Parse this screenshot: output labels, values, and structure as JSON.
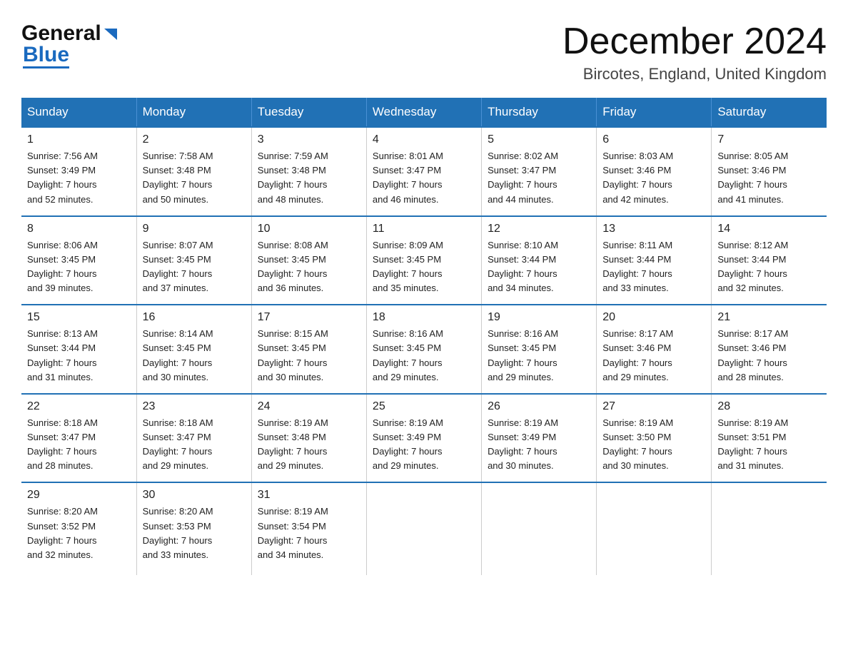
{
  "header": {
    "logo_general": "General",
    "logo_blue": "Blue",
    "month_title": "December 2024",
    "location": "Bircotes, England, United Kingdom"
  },
  "days_of_week": [
    "Sunday",
    "Monday",
    "Tuesday",
    "Wednesday",
    "Thursday",
    "Friday",
    "Saturday"
  ],
  "weeks": [
    [
      {
        "day": "1",
        "sunrise": "7:56 AM",
        "sunset": "3:49 PM",
        "daylight": "7 hours and 52 minutes."
      },
      {
        "day": "2",
        "sunrise": "7:58 AM",
        "sunset": "3:48 PM",
        "daylight": "7 hours and 50 minutes."
      },
      {
        "day": "3",
        "sunrise": "7:59 AM",
        "sunset": "3:48 PM",
        "daylight": "7 hours and 48 minutes."
      },
      {
        "day": "4",
        "sunrise": "8:01 AM",
        "sunset": "3:47 PM",
        "daylight": "7 hours and 46 minutes."
      },
      {
        "day": "5",
        "sunrise": "8:02 AM",
        "sunset": "3:47 PM",
        "daylight": "7 hours and 44 minutes."
      },
      {
        "day": "6",
        "sunrise": "8:03 AM",
        "sunset": "3:46 PM",
        "daylight": "7 hours and 42 minutes."
      },
      {
        "day": "7",
        "sunrise": "8:05 AM",
        "sunset": "3:46 PM",
        "daylight": "7 hours and 41 minutes."
      }
    ],
    [
      {
        "day": "8",
        "sunrise": "8:06 AM",
        "sunset": "3:45 PM",
        "daylight": "7 hours and 39 minutes."
      },
      {
        "day": "9",
        "sunrise": "8:07 AM",
        "sunset": "3:45 PM",
        "daylight": "7 hours and 37 minutes."
      },
      {
        "day": "10",
        "sunrise": "8:08 AM",
        "sunset": "3:45 PM",
        "daylight": "7 hours and 36 minutes."
      },
      {
        "day": "11",
        "sunrise": "8:09 AM",
        "sunset": "3:45 PM",
        "daylight": "7 hours and 35 minutes."
      },
      {
        "day": "12",
        "sunrise": "8:10 AM",
        "sunset": "3:44 PM",
        "daylight": "7 hours and 34 minutes."
      },
      {
        "day": "13",
        "sunrise": "8:11 AM",
        "sunset": "3:44 PM",
        "daylight": "7 hours and 33 minutes."
      },
      {
        "day": "14",
        "sunrise": "8:12 AM",
        "sunset": "3:44 PM",
        "daylight": "7 hours and 32 minutes."
      }
    ],
    [
      {
        "day": "15",
        "sunrise": "8:13 AM",
        "sunset": "3:44 PM",
        "daylight": "7 hours and 31 minutes."
      },
      {
        "day": "16",
        "sunrise": "8:14 AM",
        "sunset": "3:45 PM",
        "daylight": "7 hours and 30 minutes."
      },
      {
        "day": "17",
        "sunrise": "8:15 AM",
        "sunset": "3:45 PM",
        "daylight": "7 hours and 30 minutes."
      },
      {
        "day": "18",
        "sunrise": "8:16 AM",
        "sunset": "3:45 PM",
        "daylight": "7 hours and 29 minutes."
      },
      {
        "day": "19",
        "sunrise": "8:16 AM",
        "sunset": "3:45 PM",
        "daylight": "7 hours and 29 minutes."
      },
      {
        "day": "20",
        "sunrise": "8:17 AM",
        "sunset": "3:46 PM",
        "daylight": "7 hours and 29 minutes."
      },
      {
        "day": "21",
        "sunrise": "8:17 AM",
        "sunset": "3:46 PM",
        "daylight": "7 hours and 28 minutes."
      }
    ],
    [
      {
        "day": "22",
        "sunrise": "8:18 AM",
        "sunset": "3:47 PM",
        "daylight": "7 hours and 28 minutes."
      },
      {
        "day": "23",
        "sunrise": "8:18 AM",
        "sunset": "3:47 PM",
        "daylight": "7 hours and 29 minutes."
      },
      {
        "day": "24",
        "sunrise": "8:19 AM",
        "sunset": "3:48 PM",
        "daylight": "7 hours and 29 minutes."
      },
      {
        "day": "25",
        "sunrise": "8:19 AM",
        "sunset": "3:49 PM",
        "daylight": "7 hours and 29 minutes."
      },
      {
        "day": "26",
        "sunrise": "8:19 AM",
        "sunset": "3:49 PM",
        "daylight": "7 hours and 30 minutes."
      },
      {
        "day": "27",
        "sunrise": "8:19 AM",
        "sunset": "3:50 PM",
        "daylight": "7 hours and 30 minutes."
      },
      {
        "day": "28",
        "sunrise": "8:19 AM",
        "sunset": "3:51 PM",
        "daylight": "7 hours and 31 minutes."
      }
    ],
    [
      {
        "day": "29",
        "sunrise": "8:20 AM",
        "sunset": "3:52 PM",
        "daylight": "7 hours and 32 minutes."
      },
      {
        "day": "30",
        "sunrise": "8:20 AM",
        "sunset": "3:53 PM",
        "daylight": "7 hours and 33 minutes."
      },
      {
        "day": "31",
        "sunrise": "8:19 AM",
        "sunset": "3:54 PM",
        "daylight": "7 hours and 34 minutes."
      },
      null,
      null,
      null,
      null
    ]
  ],
  "labels": {
    "sunrise": "Sunrise:",
    "sunset": "Sunset:",
    "daylight": "Daylight:"
  }
}
